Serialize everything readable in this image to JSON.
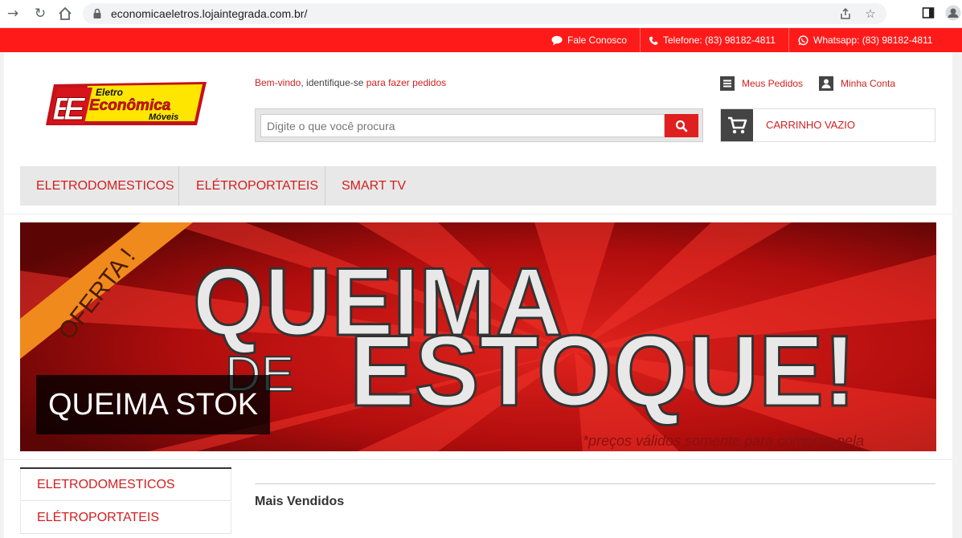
{
  "browser": {
    "url_host": "economicaeletros.lojaintegrada.com.br/",
    "url_rest": ""
  },
  "topbar": {
    "contact_label": "Fale Conosco",
    "phone_label": "Telefone: (83) 98182-4811",
    "whatsapp_label": "Whatsapp: (83) 98182-4811"
  },
  "header": {
    "logo_text_top": "Eletro",
    "logo_text_main": "Econômica",
    "logo_text_bottom": "Móveis",
    "welcome_link": "Bem-vindo",
    "welcome_mid": ", identifique-se ",
    "welcome_cta": "para fazer pedidos",
    "search_placeholder": "Digite o que você procura",
    "my_orders": "Meus Pedidos",
    "my_account": "Minha Conta",
    "cart_label": "CARRINHO VAZIO"
  },
  "menu": {
    "items": [
      "ELETRODOMESTICOS",
      "ELÉTROPORTATEIS",
      "SMART TV"
    ]
  },
  "banner": {
    "ribbon": "OFERTA !",
    "headline_1": "QUEIMA",
    "headline_2a": "DE",
    "headline_2b": "ESTOQUE!",
    "fineprint": "*preços válidos somente para compras pela",
    "caption": "QUEIMA STOK"
  },
  "sidebar": {
    "items": [
      "ELETRODOMESTICOS",
      "ELÉTROPORTATEIS"
    ]
  },
  "section": {
    "title": "Mais Vendidos"
  },
  "colors": {
    "brand_red": "#ff1a1a",
    "link_red": "#d21f1f",
    "dark_icon": "#444444"
  }
}
